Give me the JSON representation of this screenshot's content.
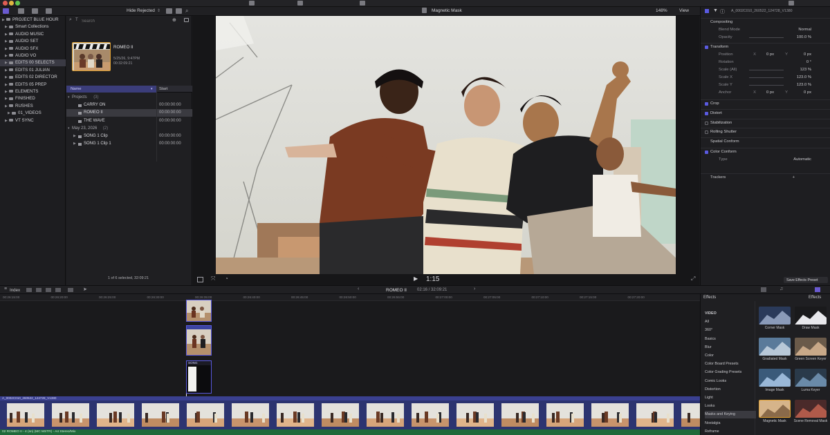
{
  "toolbar": {
    "filter_label": "Hide Rejected",
    "viewer_title": "Magnetic Mask",
    "zoom": "148%",
    "view_label": "View"
  },
  "library": {
    "items": [
      {
        "label": "PROJECT BLUE HOUR",
        "indent": 0,
        "selected": false
      },
      {
        "label": "Smart Collections",
        "indent": 1,
        "selected": false
      },
      {
        "label": "AUDIO MUSIC",
        "indent": 1,
        "selected": false
      },
      {
        "label": "AUDIO SET",
        "indent": 1,
        "selected": false
      },
      {
        "label": "AUDIO SFX",
        "indent": 1,
        "selected": false
      },
      {
        "label": "AUDIO VO",
        "indent": 1,
        "selected": false
      },
      {
        "label": "EDITS 00 SELECTS",
        "indent": 1,
        "selected": true
      },
      {
        "label": "EDITS 01 JULIAN",
        "indent": 1,
        "selected": false
      },
      {
        "label": "EDITS 02 DIRECTOR",
        "indent": 1,
        "selected": false
      },
      {
        "label": "EDITS 05 PREP",
        "indent": 1,
        "selected": false
      },
      {
        "label": "ELEMENTS",
        "indent": 1,
        "selected": false
      },
      {
        "label": "FINISHED",
        "indent": 1,
        "selected": false
      },
      {
        "label": "RUSHES",
        "indent": 1,
        "selected": false
      },
      {
        "label": "01_VIDEOS",
        "indent": 2,
        "selected": false
      },
      {
        "label": "VT SYNC",
        "indent": 1,
        "selected": false
      }
    ]
  },
  "browser": {
    "search_placeholder": "Search",
    "featured": {
      "title": "ROMEO II",
      "date": "5/25/26, 9:47PM",
      "duration": "00:32:09:21"
    },
    "columns": {
      "name": "Name",
      "start": "Start"
    },
    "rows": [
      {
        "name": "Projects",
        "count": "(3)",
        "start": "",
        "level": 0,
        "selected": false
      },
      {
        "name": "CARRY ON",
        "count": "",
        "start": "00:00:00:00",
        "level": 1,
        "selected": false
      },
      {
        "name": "ROMEO II",
        "count": "",
        "start": "00:00:00:00",
        "level": 1,
        "selected": true
      },
      {
        "name": "THE WAVE",
        "count": "",
        "start": "00:00:00:00",
        "level": 1,
        "selected": false
      },
      {
        "name": "May 23, 2026",
        "count": "(2)",
        "start": "",
        "level": 0,
        "selected": false
      },
      {
        "name": "SONG 1 Clip",
        "count": "",
        "start": "00:00:00:00",
        "level": 1,
        "selected": false
      },
      {
        "name": "SONG 1 Clip 1",
        "count": "",
        "start": "00:00:00:00",
        "level": 1,
        "selected": false
      }
    ],
    "status": "1 of 6 selected, 32:09:21"
  },
  "viewer": {
    "timecode": "1:15"
  },
  "inspector": {
    "clip_name": "A_0002C010_260522_124728_V1380",
    "rows": [
      {
        "label": "Compositing",
        "type": "section",
        "value": ""
      },
      {
        "label": "Blend Mode",
        "type": "param",
        "value": "Normal"
      },
      {
        "label": "Opacity",
        "type": "param",
        "value": "100.0 %"
      },
      {
        "label": "Transform",
        "type": "check",
        "value": ""
      },
      {
        "label": "Position",
        "type": "xy",
        "x": "0 px",
        "y": "0 px"
      },
      {
        "label": "Rotation",
        "type": "param",
        "value": "0 °"
      },
      {
        "label": "Scale (All)",
        "type": "param",
        "value": "123 %"
      },
      {
        "label": "Scale X",
        "type": "param",
        "value": "123.0 %"
      },
      {
        "label": "Scale Y",
        "type": "param",
        "value": "123.0 %"
      },
      {
        "label": "Anchor",
        "type": "xy",
        "x": "0 px",
        "y": "0 px"
      },
      {
        "label": "Crop",
        "type": "check",
        "value": ""
      },
      {
        "label": "Distort",
        "type": "check",
        "value": ""
      },
      {
        "label": "Stabilization",
        "type": "checkoff",
        "value": ""
      },
      {
        "label": "Rolling Shutter",
        "type": "checkoff",
        "value": ""
      },
      {
        "label": "Spatial Conform",
        "type": "section",
        "value": ""
      },
      {
        "label": "Color Conform",
        "type": "check",
        "value": ""
      },
      {
        "label": "Type",
        "type": "param",
        "value": "Automatic"
      },
      {
        "label": "Trackers",
        "type": "section",
        "value": "+"
      }
    ],
    "save_button": "Save Effects Preset"
  },
  "timeline": {
    "index_label": "Index",
    "project_name": "ROMEO II",
    "position": "02:16 / 32:09:21",
    "ruler": [
      "00:26:15:00",
      "00:26:20:00",
      "00:26:25:00",
      "00:26:30:00",
      "00:26:35:00",
      "00:26:40:00",
      "00:26:45:00",
      "00:26:50:00",
      "00:26:55:00",
      "00:27:00:00",
      "00:27:05:00",
      "00:27:10:00",
      "00:27:15:00",
      "00:27:20:00"
    ],
    "storyline_label": "A_0002C010_260522_124728_V1380",
    "connected_label": "SONG",
    "audio_label": "02 ROMEO II - 4 (sn) (MC MSTR) - A4 Stereo/Mix"
  },
  "effects": {
    "header": "Effects",
    "categories": [
      {
        "label": "VIDEO",
        "selected": false
      },
      {
        "label": "All",
        "selected": false
      },
      {
        "label": "360°",
        "selected": false
      },
      {
        "label": "Basics",
        "selected": false
      },
      {
        "label": "Blur",
        "selected": false
      },
      {
        "label": "Color",
        "selected": false
      },
      {
        "label": "Color Board Presets",
        "selected": false
      },
      {
        "label": "Color Grading Presets",
        "selected": false
      },
      {
        "label": "Comic Looks",
        "selected": false
      },
      {
        "label": "Distortion",
        "selected": false
      },
      {
        "label": "Light",
        "selected": false
      },
      {
        "label": "Looks",
        "selected": false
      },
      {
        "label": "Masks and Keying",
        "selected": true
      },
      {
        "label": "Nostalgia",
        "selected": false
      },
      {
        "label": "Reframe",
        "selected": false
      }
    ],
    "tiles": [
      {
        "label": "Corner Mask"
      },
      {
        "label": "Draw Mask"
      },
      {
        "label": "Gradiated Mask"
      },
      {
        "label": "Green Screen Keyer"
      },
      {
        "label": "Image Mask"
      },
      {
        "label": "Luma Keyer"
      },
      {
        "label": "Magnetic Mask"
      },
      {
        "label": "Scene Removal Mask"
      }
    ]
  },
  "colors": {
    "accent": "#5a5ae0",
    "background": "#1b1b1d",
    "selection": "#3a3a44"
  }
}
